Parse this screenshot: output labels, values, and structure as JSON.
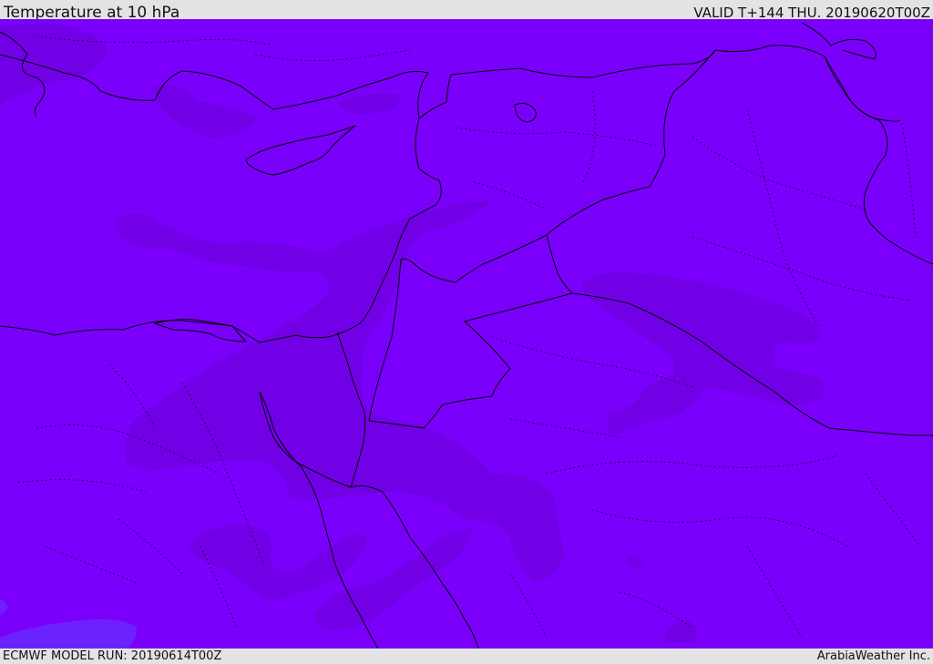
{
  "header": {
    "title": "Temperature at 10 hPa",
    "valid": "VALID T+144 THU. 20190620T00Z"
  },
  "footer": {
    "model_run": "ECMWF MODEL RUN: 20190614T00Z",
    "credit": "ArabiaWeather Inc."
  },
  "map": {
    "base_color": "#7a00fb",
    "band_color": "#7200e6",
    "cool_color": "#6c22ff",
    "border_color": "#000000"
  }
}
